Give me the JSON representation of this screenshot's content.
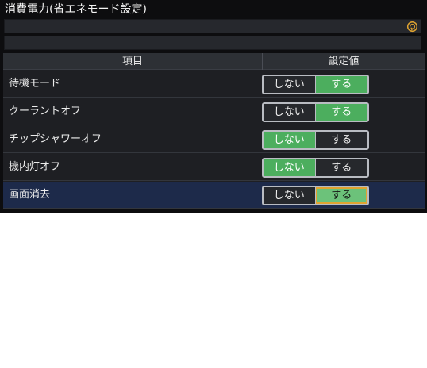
{
  "header": {
    "title": "消費電力(省エネモード設定)"
  },
  "bars": {
    "icon": "refresh-circle-icon"
  },
  "table": {
    "columns": [
      "項目",
      "設定値"
    ],
    "rows": [
      {
        "label": "待機モード",
        "off": "しない",
        "on": "する",
        "selected_value": "する",
        "highlighted": false
      },
      {
        "label": "クーラントオフ",
        "off": "しない",
        "on": "する",
        "selected_value": "する",
        "highlighted": false
      },
      {
        "label": "チップシャワーオフ",
        "off": "しない",
        "on": "する",
        "selected_value": "しない",
        "highlighted": false
      },
      {
        "label": "機内灯オフ",
        "off": "しない",
        "on": "する",
        "selected_value": "しない",
        "highlighted": false
      },
      {
        "label": "画面消去",
        "off": "しない",
        "on": "する",
        "selected_value": "する",
        "highlighted": true
      }
    ]
  },
  "colors": {
    "panel_bg": "#0d0d0f",
    "selected_option": "#4cae5e",
    "focused_option": "#6cc27a",
    "focus_border": "#e0a431",
    "highlight_row": "#1d2a4a"
  }
}
